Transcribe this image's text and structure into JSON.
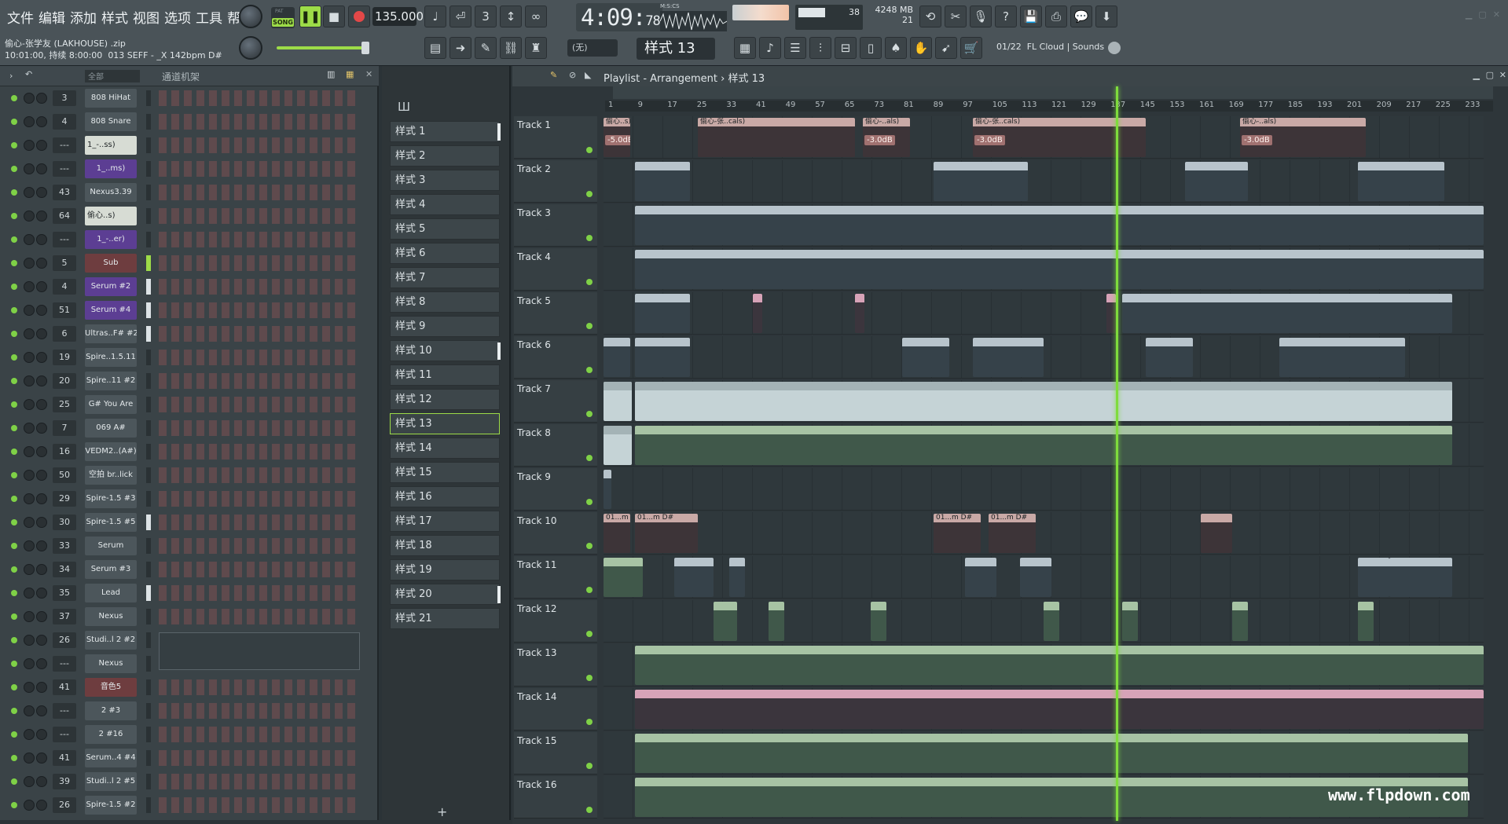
{
  "menu": [
    "文件",
    "编辑",
    "添加",
    "样式",
    "视图",
    "选项",
    "工具",
    "帮助"
  ],
  "project": {
    "file": "偷心-张学友 (LAKHOUSE) .zip",
    "info": "10:01:00, 持续 8:00:00",
    "meta": "013 SEFF - _X 142bpm D#"
  },
  "transport": {
    "mode_pat": "PAT",
    "mode_song": "SONG",
    "tempo": "135.000",
    "time_main": "4:09",
    "time_sub": "78",
    "time_unit": "M:S:CS"
  },
  "cpu": {
    "value": "38",
    "mem": "4248 MB",
    "voices": "21"
  },
  "pattern_selector": {
    "current": "样式 13",
    "none": "(无)"
  },
  "cloud": {
    "counter": "01/22",
    "label": "FL Cloud | Sounds"
  },
  "rack": {
    "title": "通道机架",
    "filter": "全部"
  },
  "channels": [
    {
      "num": "3",
      "name": "808 HiHat",
      "style": ""
    },
    {
      "num": "4",
      "name": "808 Snare",
      "style": ""
    },
    {
      "num": "---",
      "name": "1_-..ss)",
      "style": "light"
    },
    {
      "num": "---",
      "name": "1_..ms)",
      "style": "purple"
    },
    {
      "num": "43",
      "name": "Nexus3.39",
      "style": ""
    },
    {
      "num": "64",
      "name": "偷心..s)",
      "style": "light"
    },
    {
      "num": "---",
      "name": "1_-..er)",
      "style": "purple"
    },
    {
      "num": "5",
      "name": "Sub",
      "style": "red"
    },
    {
      "num": "4",
      "name": "Serum #2",
      "style": "purple"
    },
    {
      "num": "51",
      "name": "Serum #4",
      "style": "purple"
    },
    {
      "num": "6",
      "name": "Ultras..F# #2",
      "style": ""
    },
    {
      "num": "19",
      "name": "Spire..1.5.11",
      "style": ""
    },
    {
      "num": "20",
      "name": "Spire..11 #2",
      "style": ""
    },
    {
      "num": "25",
      "name": "G# You Are",
      "style": ""
    },
    {
      "num": "7",
      "name": "069 A#",
      "style": ""
    },
    {
      "num": "16",
      "name": "VEDM2..(A#)",
      "style": ""
    },
    {
      "num": "50",
      "name": "空拍 br..lick",
      "style": ""
    },
    {
      "num": "29",
      "name": "Spire-1.5 #3",
      "style": ""
    },
    {
      "num": "30",
      "name": "Spire-1.5 #5",
      "style": ""
    },
    {
      "num": "33",
      "name": "Serum",
      "style": ""
    },
    {
      "num": "34",
      "name": "Serum #3",
      "style": ""
    },
    {
      "num": "35",
      "name": "Lead",
      "style": ""
    },
    {
      "num": "37",
      "name": "Nexus",
      "style": ""
    },
    {
      "num": "26",
      "name": "Studi..l 2 #2",
      "style": ""
    },
    {
      "num": "---",
      "name": "Nexus",
      "style": ""
    },
    {
      "num": "41",
      "name": "音色5",
      "style": "red"
    },
    {
      "num": "---",
      "name": "2 #3",
      "style": ""
    },
    {
      "num": "---",
      "name": "2 #16",
      "style": ""
    },
    {
      "num": "41",
      "name": "Serum..4 #4",
      "style": ""
    },
    {
      "num": "39",
      "name": "Studi..l 2 #5",
      "style": ""
    },
    {
      "num": "26",
      "name": "Spire-1.5 #2",
      "style": ""
    }
  ],
  "patterns": [
    "样式 1",
    "样式 2",
    "样式 3",
    "样式 4",
    "样式 5",
    "样式 6",
    "样式 7",
    "样式 8",
    "样式 9",
    "样式 10",
    "样式 11",
    "样式 12",
    "样式 13",
    "样式 14",
    "样式 15",
    "样式 16",
    "样式 17",
    "样式 18",
    "样式 19",
    "样式 20",
    "样式 21"
  ],
  "playlist": {
    "title": "Playlist - Arrangement",
    "crumb": "样式 13",
    "ruler": [
      "1",
      "9",
      "17",
      "25",
      "33",
      "41",
      "49",
      "57",
      "65",
      "73",
      "81",
      "89",
      "97",
      "105",
      "113",
      "121",
      "129",
      "137",
      "145",
      "153",
      "161",
      "169",
      "177",
      "185",
      "193",
      "201",
      "209",
      "217",
      "225",
      "233"
    ],
    "tracks": [
      "Track 1",
      "Track 2",
      "Track 3",
      "Track 4",
      "Track 5",
      "Track 6",
      "Track 7",
      "Track 8",
      "Track 9",
      "Track 10",
      "Track 11",
      "Track 12",
      "Track 13",
      "Track 14",
      "Track 15",
      "Track 16"
    ],
    "clip_labels": {
      "t1a": "偷心..s)",
      "t1b": "偷心-张..cals)",
      "t1c": "偷心-..als)",
      "t10": "01...m D#",
      "vol": "-5.0dB",
      "vol2": "-3.0dB"
    }
  },
  "watermark": "www.flpdown.com"
}
